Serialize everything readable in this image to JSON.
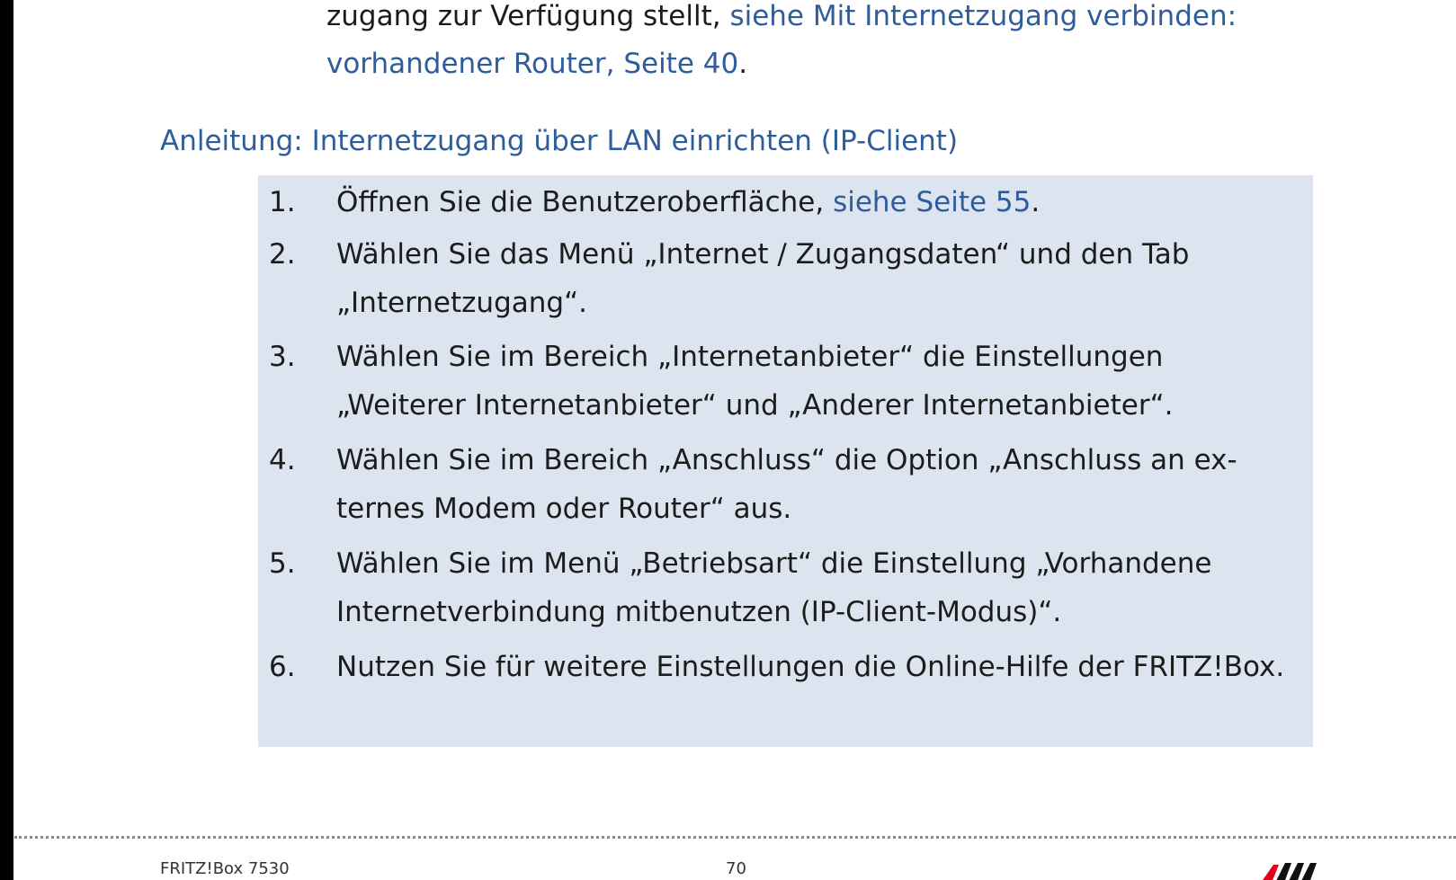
{
  "intro": {
    "text": "zugang zur Verfügung stellt, ",
    "link": "siehe Mit Internetzugang verbinden: vorhandener Router, Seite 40",
    "end": "."
  },
  "section": {
    "heading": "Anleitung: Internetzugang über LAN einrichten (IP-Client)"
  },
  "steps": [
    {
      "num": "1.",
      "text": "Öffnen Sie die Benutzeroberfläche, ",
      "link": "siehe Seite 55",
      "end": "."
    },
    {
      "num": "2.",
      "text": "Wählen Sie das Menü „Internet / Zugangsdaten“ und den Tab „Internetzugang“."
    },
    {
      "num": "3.",
      "text": "Wählen Sie im Bereich „Internetanbieter“ die Einstellungen „Weiterer Internetanbieter“ und „Anderer Internetanbieter“."
    },
    {
      "num": "4.",
      "text": "Wählen Sie im Bereich „Anschluss“ die Option „Anschluss an ex-ternes Modem oder Router“ aus."
    },
    {
      "num": "5.",
      "text": "Wählen Sie im Menü „Betriebsart“ die Einstellung „Vorhandene Internetverbindung mitbenutzen (IP-Client-Modus)“."
    },
    {
      "num": "6.",
      "text": "Nutzen Sie für weitere Einstellungen die Online-Hilfe der FRITZ!Box."
    }
  ],
  "footer": {
    "product": "FRITZ!Box 7530",
    "page": "70",
    "logo_icon": "avm-logo-icon"
  },
  "colors": {
    "link": "#2f5d9a",
    "box_background": "#dce4ef",
    "text": "#1c1c1c",
    "logo_red": "#e2001a"
  }
}
